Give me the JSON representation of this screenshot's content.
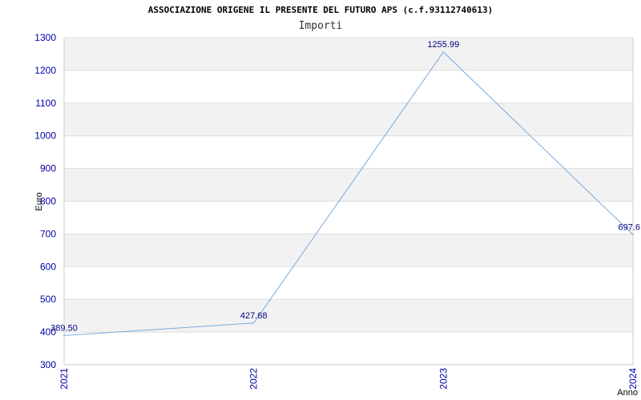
{
  "header": {
    "title": "ASSOCIAZIONE ORIGENE IL PRESENTE DEL FUTURO APS (c.f.93112740613)",
    "subtitle": "Importi"
  },
  "colors": {
    "line": "#77aadd",
    "band": "#f2f2f2",
    "tick_text": "#0000aa",
    "label_text": "#000080",
    "grid": "#dddddd"
  },
  "chart_data": {
    "type": "line",
    "title": "ASSOCIAZIONE ORIGENE IL PRESENTE DEL FUTURO APS (c.f.93112740613)",
    "subtitle": "Importi",
    "xlabel": "Anno",
    "ylabel": "Euro",
    "categories": [
      "2021",
      "2022",
      "2023",
      "2024"
    ],
    "series": [
      {
        "values": [
          389.5,
          427.68,
          1255.99,
          697.6
        ]
      }
    ],
    "data_labels": [
      "389.50",
      "427.68",
      "1255.99",
      "697.6"
    ],
    "ylim": [
      300,
      1300
    ],
    "yticks": [
      300,
      400,
      500,
      600,
      700,
      800,
      900,
      1000,
      1100,
      1200,
      1300
    ],
    "grid": true,
    "alternating_bands": true
  }
}
